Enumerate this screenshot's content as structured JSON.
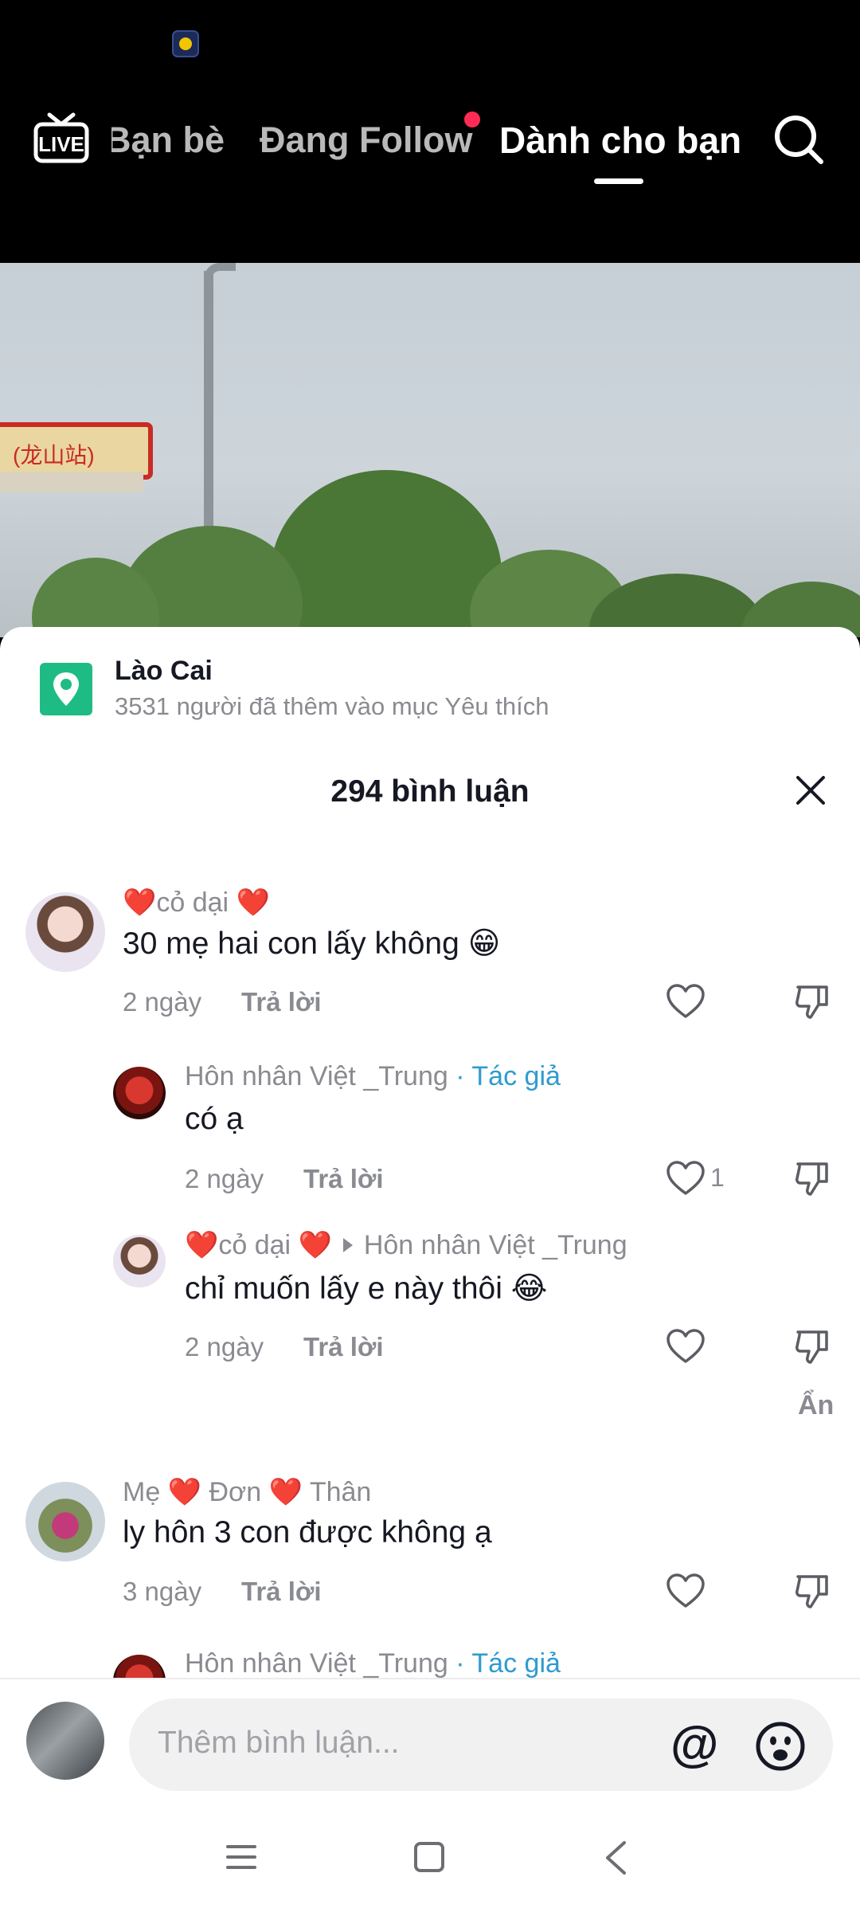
{
  "top_nav": {
    "tabs": [
      "Bạn bè",
      "Đang Follow",
      "Dành cho bạn"
    ],
    "active_tab": "Dành cho bạn",
    "live_label": "LIVE"
  },
  "video": {
    "sign_text": "(龙山站)"
  },
  "location": {
    "name": "Lào Cai",
    "favorites_text": "3531 người đã thêm vào mục Yêu thích"
  },
  "comments_header": {
    "title": "294 bình luận"
  },
  "comments": [
    {
      "username": "❤️cỏ dại ❤️",
      "text": "30 mẹ hai con lấy không 😁",
      "date": "2 ngày",
      "reply_label": "Trả lời",
      "likes": ""
    },
    {
      "username": "Hôn nhân Việt _Trung",
      "author_tag": "· Tác giả",
      "text": "có ạ",
      "date": "2 ngày",
      "reply_label": "Trả lời",
      "likes": "1"
    },
    {
      "username": "❤️cỏ dại ❤️",
      "reply_to": "Hôn nhân Việt _Trung",
      "text": "chỉ muốn lấy e này thôi 😂",
      "date": "2 ngày",
      "reply_label": "Trả lời",
      "likes": ""
    },
    {
      "username": "Mẹ ❤️ Đơn ❤️ Thân",
      "text": "ly hôn 3 con được không ạ",
      "date": "3 ngày",
      "reply_label": "Trả lời",
      "likes": ""
    },
    {
      "username": "Hôn nhân Việt _Trung",
      "author_tag": "· Tác giả"
    }
  ],
  "hide_label": "Ẩn",
  "input": {
    "placeholder": "Thêm bình luận...",
    "mention_symbol": "@"
  },
  "colors": {
    "accent_author": "#2f9bd0",
    "location_icon": "#1ebc84",
    "notification_dot": "#fe2c55"
  }
}
